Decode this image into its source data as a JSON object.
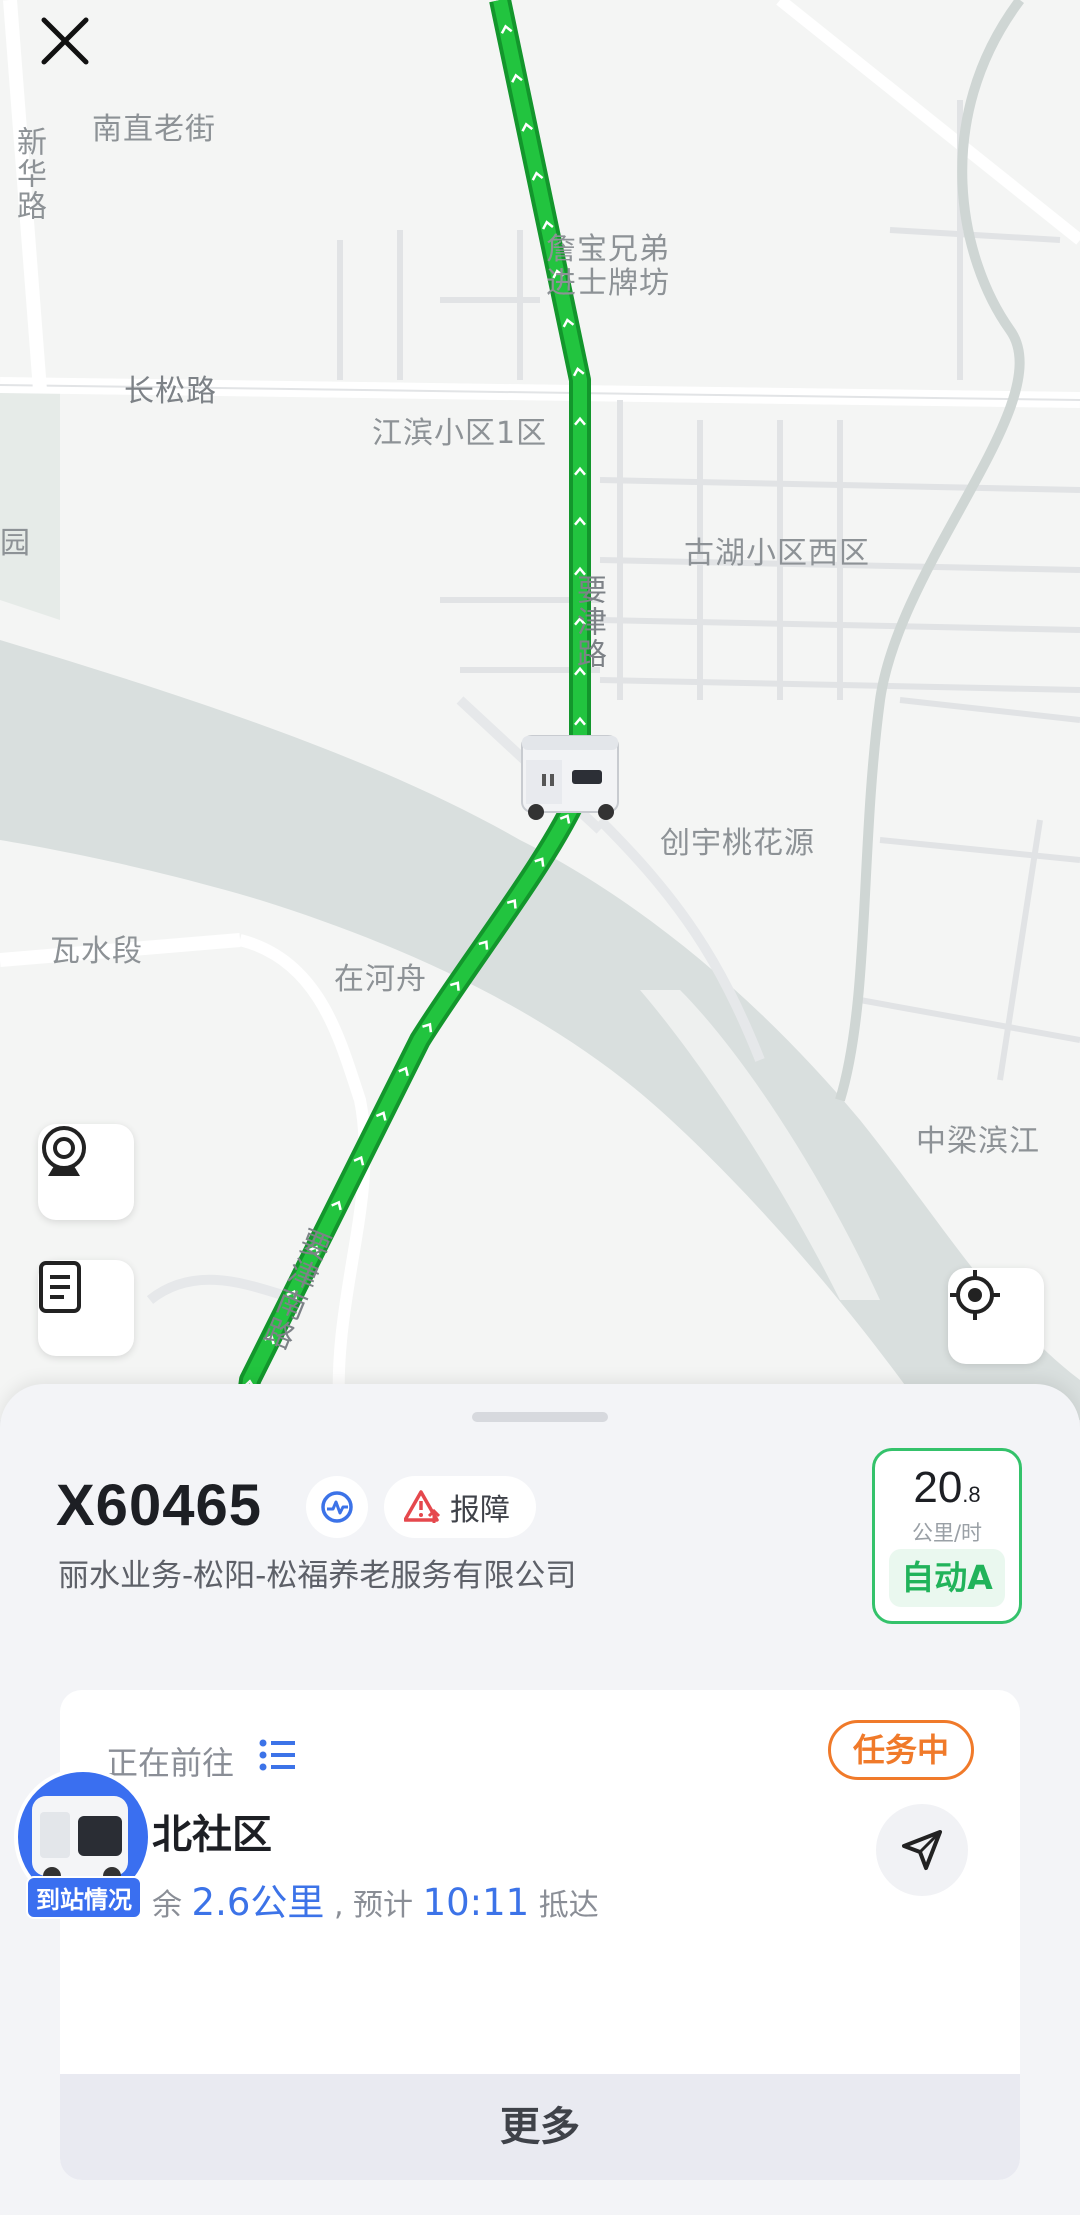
{
  "map": {
    "labels": {
      "nanzhi": "南直老街",
      "xinhua": "新华路",
      "jinbao": "詹宝兄弟",
      "jinshi": "进士牌坊",
      "changsong": "长松路",
      "jiangbin": "江滨小区1区",
      "guhu": "古湖小区西区",
      "yaojin": "要津路",
      "yaojin_south": "要津南路",
      "chuangyu": "创宇桃花源",
      "washui": "瓦水段",
      "zaihe": "在河舟",
      "zhongliang": "中梁滨江",
      "yuan": "园"
    },
    "route_color": "#1fb53a"
  },
  "controls": {
    "close_icon": "close-icon",
    "camera_icon": "camera-icon",
    "log_icon": "document-icon",
    "locate_icon": "locate-icon"
  },
  "vehicle": {
    "id": "X60465",
    "report_label": "报障",
    "company": "丽水业务-松阳-松福养老服务有限公司",
    "speed_int": "20",
    "speed_dec": ".8",
    "speed_unit": "公里/时",
    "mode": "自动A"
  },
  "task": {
    "heading": "正在前往",
    "status": "任务中",
    "destination": "北社区",
    "eta_prefix": "余",
    "distance": "2.6公里",
    "eta_mid": ", 预计",
    "arrival_time": "10:11",
    "eta_suffix": "抵达",
    "more_label": "更多"
  },
  "arrival": {
    "label": "到站情况"
  },
  "colors": {
    "accent_blue": "#3c73e8",
    "success_green": "#34c26b",
    "warning_orange": "#f07a2a",
    "alert_red": "#e5484d"
  }
}
